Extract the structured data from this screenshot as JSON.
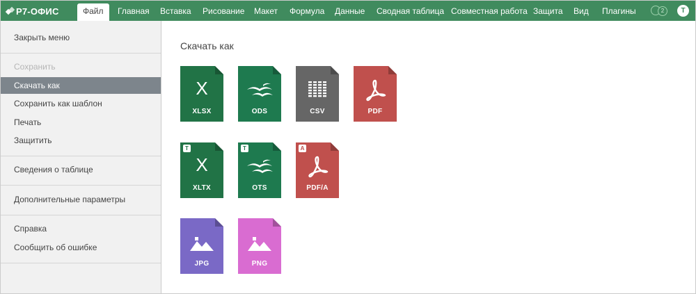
{
  "topbar": {
    "logo": "Р7-ОФИС",
    "tabs": [
      "Файл",
      "Главная",
      "Вставка",
      "Рисование",
      "Макет",
      "Формула",
      "Данные",
      "Сводная таблица",
      "Совместная работа",
      "Защита",
      "Вид",
      "Плагины"
    ],
    "active_tab": "Файл",
    "coediting_count": "2",
    "user_initial": "Т",
    "accent_color": "#408b5e"
  },
  "leftmenu": {
    "items": [
      "Закрыть меню",
      "Сохранить",
      "Скачать как",
      "Сохранить как шаблон",
      "Печать",
      "Защитить",
      "Сведения о таблице",
      "Дополнительные параметры",
      "Справка",
      "Сообщить об ошибке"
    ],
    "disabled": [
      "Сохранить"
    ],
    "selected": "Скачать как"
  },
  "panel": {
    "title": "Скачать как",
    "formats": [
      {
        "label": "XLSX",
        "color": "#217346",
        "icon": "spreadsheet-x-icon"
      },
      {
        "label": "ODS",
        "color": "#1e7a4f",
        "icon": "seagulls-icon"
      },
      {
        "label": "CSV",
        "color": "#666666",
        "icon": "grid-icon"
      },
      {
        "label": "PDF",
        "color": "#c0504d",
        "icon": "acrobat-icon"
      },
      {
        "label": "XLTX",
        "color": "#217346",
        "icon": "spreadsheet-x-icon",
        "badge": "T"
      },
      {
        "label": "OTS",
        "color": "#1e7a4f",
        "icon": "seagulls-icon",
        "badge": "T"
      },
      {
        "label": "PDF/A",
        "color": "#c0504d",
        "icon": "acrobat-icon",
        "badge": "A"
      },
      {
        "label": "JPG",
        "color": "#7a69c6",
        "icon": "image-icon"
      },
      {
        "label": "PNG",
        "color": "#d96cd1",
        "icon": "image-icon"
      }
    ]
  }
}
